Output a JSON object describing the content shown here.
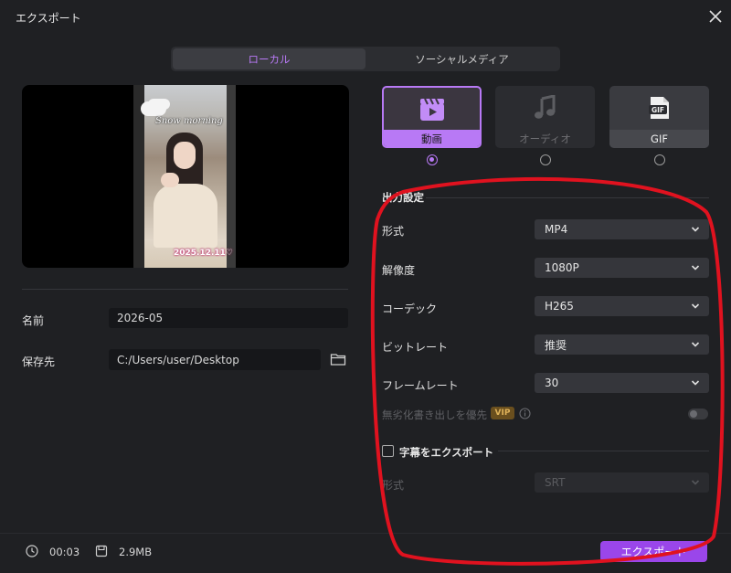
{
  "window": {
    "title": "エクスポート"
  },
  "tabs": [
    {
      "label": "ローカル",
      "active": true
    },
    {
      "label": "ソーシャルメディア",
      "active": false
    }
  ],
  "preview": {
    "overlay_text": "Snow morning",
    "date_text": "2025.12.11♡"
  },
  "left": {
    "name_label": "名前",
    "name_value": "2026-05",
    "save_label": "保存先",
    "save_value": "C:/Users/user/Desktop"
  },
  "format_cards": [
    {
      "label": "動画",
      "icon": "clapperboard-icon",
      "selected": true
    },
    {
      "label": "オーディオ",
      "icon": "music-note-icon",
      "selected": false,
      "disabled": true
    },
    {
      "label": "GIF",
      "icon": "gif-file-icon",
      "selected": false
    }
  ],
  "output": {
    "section_title": "出力設定",
    "rows": [
      {
        "label": "形式",
        "value": "MP4"
      },
      {
        "label": "解像度",
        "value": "1080P"
      },
      {
        "label": "コーデック",
        "value": "H265"
      },
      {
        "label": "ビットレート",
        "value": "推奨"
      },
      {
        "label": "フレームレート",
        "value": "30"
      }
    ],
    "lossless_label": "無劣化書き出しを優先",
    "vip_badge": "VIP",
    "lossless_enabled": false
  },
  "subtitle": {
    "checkbox_label": "字幕をエクスポート",
    "checked": false,
    "format_label": "形式",
    "format_value": "SRT"
  },
  "footer": {
    "duration": "00:03",
    "size": "2.9MB",
    "export_label": "エクスポート"
  },
  "colors": {
    "accent": "#b879f5",
    "button": "#9a46ea",
    "annotation": "#e0121f",
    "background": "#1f2023"
  }
}
